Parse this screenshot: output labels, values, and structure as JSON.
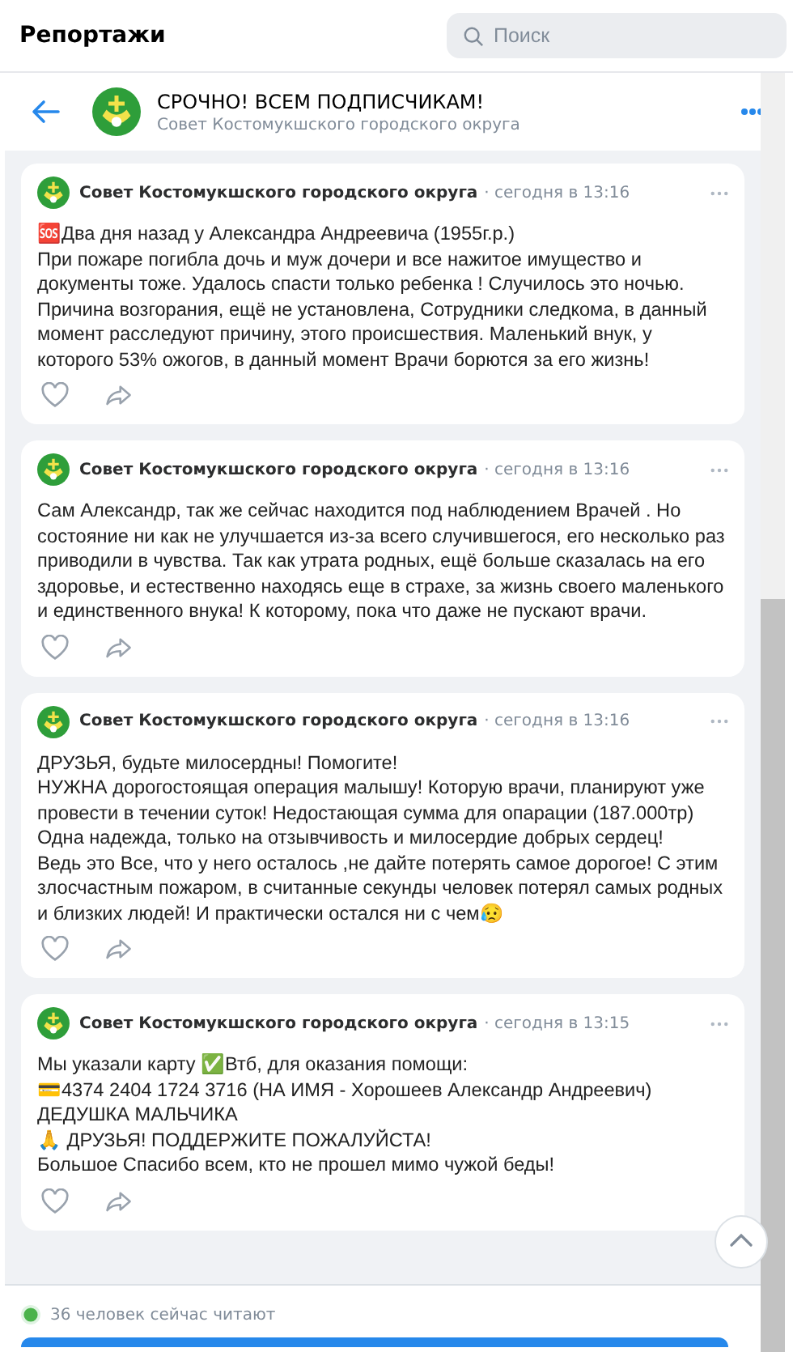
{
  "header": {
    "title": "Репортажи",
    "search": {
      "placeholder": "Поиск"
    }
  },
  "chat": {
    "title": "СРОЧНО! ВСЕМ ПОДПИСЧИКАМ!",
    "subtitle": "Совет Костомукшского городского округа"
  },
  "posts": [
    {
      "author": "Совет Костомукшского городского округа",
      "time": "· сегодня в 13:16",
      "text": "🆘Два дня назад у Александра Андреевича (1955г.р.)\nПри пожаре погибла дочь и муж дочери и все нажитое имущество и документы тоже. Удалось спасти только ребенка ! Случилось это ночью. Причина возгорания, ещё не установлена, Сотрудники следкома, в данный момент расследуют причину, этого происшествия. Маленький внук, у которого 53% ожогов, в данный момент Врачи борются за его жизнь!"
    },
    {
      "author": "Совет Костомукшского городского округа",
      "time": "· сегодня в 13:16",
      "text": "Сам Александр, так же сейчас находится под наблюдением Врачей . Но состояние ни как не улучшается из-за всего случившегося, его несколько раз приводили в чувства. Так как утрата родных, ещё больше сказалась на его здоровье, и естественно находясь еще в страхе, за жизнь своего маленького и единственного внука! К которому, пока что даже не пускают врачи."
    },
    {
      "author": "Совет Костомукшского городского округа",
      "time": "· сегодня в 13:16",
      "text": "ДРУЗЬЯ, будьте милосердны! Помогите!\nНУЖНА дорогостоящая операция малышу! Которую врачи, планируют уже провести в течении суток! Недостающая сумма для опарации (187.000тр)\nОдна надежда, только на отзывчивость и милосердие добрых сердец!\nВедь это Все, что у него осталось ,не дайте потерять самое дорогое! С этим злосчастным пожаром, в считанные секунды человек потерял самых родных и близких людей! И практически остался ни с чем😥"
    },
    {
      "author": "Совет Костомукшского городского округа",
      "time": "· сегодня в 13:15",
      "text": "Мы указали карту ✅Втб, для оказания помощи:\n💳4374 2404 1724 3716 (НА ИМЯ - Хорошеев Александр Андреевич)\nДЕДУШКА МАЛЬЧИКА\n🙏 ДРУЗЬЯ! ПОДДЕРЖИТЕ ПОЖАЛУЙСТА!\nБольшое Спасибо всем, кто не прошел мимо чужой беды!"
    }
  ],
  "footer": {
    "readers": "36 человек сейчас читают"
  }
}
